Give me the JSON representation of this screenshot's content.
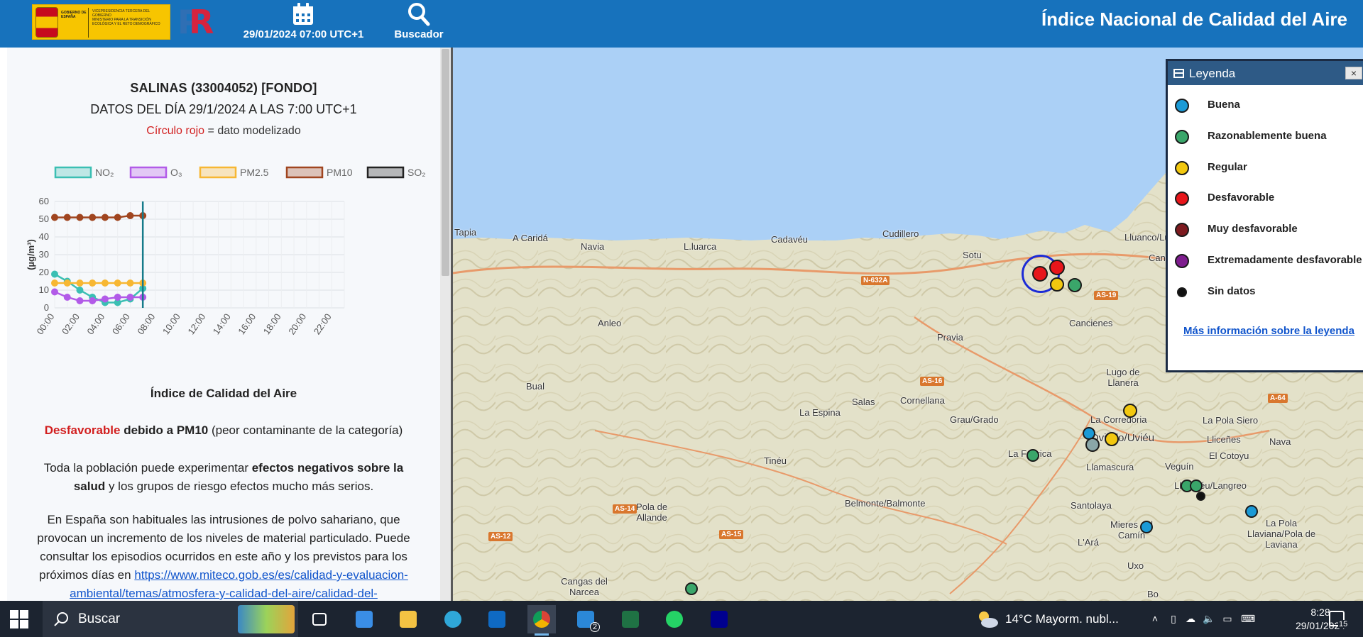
{
  "header": {
    "logo_government": "GOBIERNO DE ESPAÑA",
    "logo_vicepresidency": "VICEPRESIDENCIA TERCERA DEL GOBIERNO",
    "logo_ministry": "MINISTERIO PARA LA TRANSICIÓN ECOLÓGICA Y EL RETO DEMOGRÁFICO",
    "date_label": "29/01/2024 07:00 UTC+1",
    "search_label": "Buscador",
    "title": "Índice Nacional de Calidad del Aire",
    "brand_color": "#1772bc"
  },
  "panel": {
    "station": "SALINAS (33004052) [FONDO]",
    "data_day": "DATOS DEL DÍA 29/1/2024 A LAS 7:00 UTC+1",
    "modeled_red": "Círculo rojo",
    "modeled_rest": " = dato modelizado",
    "aqi_heading": "Índice de Calidad del Aire",
    "status_word": "Desfavorable",
    "status_due": " debido a PM10",
    "status_note": " (peor contaminante de la categoría)",
    "effects_1": "Toda la población puede experimentar ",
    "effects_b": "efectos negativos sobre la salud",
    "effects_2": " y los grupos de riesgo efectos mucho más serios.",
    "sahara_text": "En España son habituales las intrusiones de polvo sahariano, que provocan un incremento de los niveles de material particulado. Puede consultar los episodios ocurridos en este año y los previstos para los próximos días en ",
    "sahara_link": "https://www.miteco.gob.es/es/calidad-y-evaluacion-ambiental/temas/atmosfera-y-calidad-del-aire/calidad-del-"
  },
  "chart_data": {
    "type": "line",
    "ylabel": "(µg/m³)",
    "ylim": [
      0,
      60
    ],
    "yticks": [
      0,
      10,
      20,
      30,
      40,
      50,
      60
    ],
    "x_ticks": [
      "00:00",
      "02:00",
      "04:00",
      "06:00",
      "08:00",
      "10:00",
      "12:00",
      "14:00",
      "16:00",
      "18:00",
      "20:00",
      "22:00"
    ],
    "x_hours": [
      0,
      1,
      2,
      3,
      4,
      5,
      6,
      7
    ],
    "current_hour": 7,
    "legend_position": "top",
    "grid": true,
    "series": [
      {
        "name": "NO₂",
        "color": "#3bbfb3",
        "values": [
          19,
          15,
          10,
          6,
          3,
          3,
          5,
          11
        ]
      },
      {
        "name": "O₃",
        "color": "#b25be8",
        "values": [
          9,
          6,
          4,
          4,
          5,
          6,
          6,
          6
        ]
      },
      {
        "name": "PM2.5",
        "color": "#f7b733",
        "values": [
          14,
          14,
          14,
          14,
          14,
          14,
          14,
          14
        ]
      },
      {
        "name": "PM10",
        "color": "#a0451f",
        "values": [
          51,
          51,
          51,
          51,
          51,
          51,
          52,
          52
        ]
      },
      {
        "name": "SO₂",
        "color": "#222222",
        "values": []
      }
    ]
  },
  "legend": {
    "title": "Leyenda",
    "close": "×",
    "items": [
      {
        "label": "Buena",
        "color": "#1b9ad6"
      },
      {
        "label": "Razonablemente buena",
        "color": "#3aa66a"
      },
      {
        "label": "Regular",
        "color": "#f2c80f"
      },
      {
        "label": "Desfavorable",
        "color": "#e8161b"
      },
      {
        "label": "Muy desfavorable",
        "color": "#7d1a1f"
      },
      {
        "label": "Extremadamente desfavorable",
        "color": "#7e1d8e"
      },
      {
        "label": "Sin datos",
        "color": "#111111"
      }
    ],
    "link": "Más información sobre la leyenda"
  },
  "map": {
    "places": [
      "Tapia",
      "A Caridá",
      "Navia",
      "L.luarca",
      "Cadavéu",
      "Cudillero",
      "Sotu",
      "Anleo",
      "Pravia",
      "Cancienes",
      "Lugo de Llanera",
      "Bual",
      "La Espina",
      "Salas",
      "Cornellana",
      "Grau/Grado",
      "La Corredoria",
      "Oviedo/Uviéu",
      "La Fábrica",
      "Llamascura",
      "Tinéu",
      "Veguín",
      "Llangréu/Langreo",
      "La Pola Siero",
      "Lliceñes",
      "El Cotoyu",
      "Nava",
      "Belmonte/Balmonte",
      "Santolaya",
      "Pola de Allande",
      "L'Ará",
      "Mieres del Camín",
      "La Pola Llaviana/Pola de Laviana",
      "Uxo",
      "Bo",
      "Cangas del Narcea",
      "Lluanco/Luanco",
      "Candás"
    ],
    "roads": [
      "N-632A",
      "AS-19",
      "AS-16",
      "AS-14",
      "AS-15",
      "AS-12",
      "A-64"
    ]
  },
  "taskbar": {
    "search": "Buscar",
    "weather": "14°C  Mayorm. nubl...",
    "time": "8:28",
    "date": "29/01/2024",
    "mail_badge": "2",
    "notif_count": "15"
  }
}
